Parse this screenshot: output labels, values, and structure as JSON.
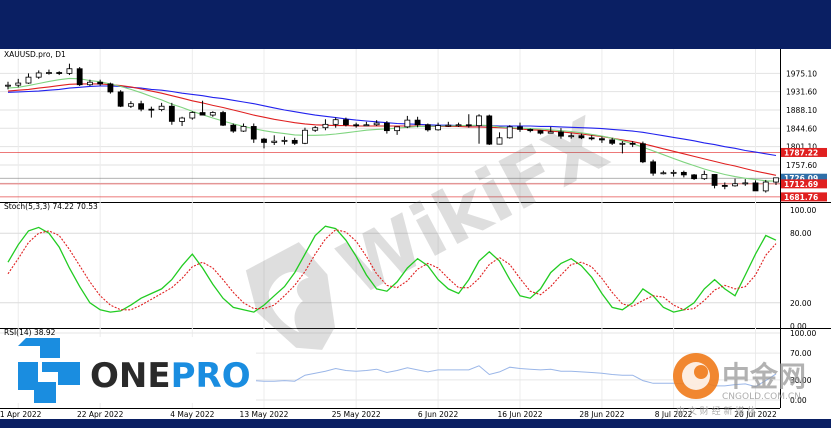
{
  "colors": {
    "frame": "#0a1f63",
    "panel_bg": "#ffffff",
    "grid": "#d8d8d8",
    "bull_fill": "#ffffff",
    "bear_fill": "#000000",
    "ma_blue": "#2222ee",
    "ma_red": "#e02020",
    "ma_green": "#7fd47f",
    "stoch_k": "#22cc22",
    "stoch_d": "#e02020",
    "rsi_line": "#9ab6e8",
    "tag_red": "#e02020",
    "tag_blue": "#2f6fa8",
    "logo_blue": "#1a8de0",
    "logo_text": "#2a2a2a",
    "watermark_orange": "#f07a1a"
  },
  "price_panel": {
    "label": "XAUUSD.pro, D1",
    "axis_ticks": [
      "1975.10",
      "1931.60",
      "1888.10",
      "1844.60",
      "1801.10",
      "1757.60",
      "1714.10"
    ],
    "price_tags": [
      {
        "text": "1787.22",
        "color": "red"
      },
      {
        "text": "1726.09",
        "color": "blue"
      },
      {
        "text": "1712.69",
        "color": "red"
      },
      {
        "text": "1681.76",
        "color": "red"
      }
    ]
  },
  "stoch_panel": {
    "label": "Stoch(5,3,3) 74.22 70.53",
    "axis_ticks": [
      "100.00",
      "80.00",
      "20.00",
      "0.00"
    ]
  },
  "rsi_panel": {
    "label": "RSI(14) 38.92",
    "axis_ticks": [
      "100.00",
      "70.00",
      "30.00",
      "0.00"
    ]
  },
  "x_axis": {
    "labels": [
      "11 Apr 2022",
      "22 Apr 2022",
      "4 May 2022",
      "13 May 2022",
      "25 May 2022",
      "6 Jun 2022",
      "16 Jun 2022",
      "28 Jun 2022",
      "8 Jul 2022",
      "20 Jul 2022"
    ]
  },
  "branding": {
    "logo_left": "ONE",
    "logo_right": "PRO",
    "watermark": "WikiFX",
    "cngold_name": "中金网",
    "cngold_url": "CNGOLD.COM.CN",
    "cngold_tagline": "中 文 财 经 新 媒 体"
  },
  "chart_data": [
    {
      "type": "candlestick",
      "symbol": "XAUUSD.pro",
      "timeframe": "D1",
      "title": "XAUUSD.pro, D1",
      "ylim": [
        1672,
        2002
      ],
      "x": [
        "2022-04-08",
        "2022-04-11",
        "2022-04-12",
        "2022-04-13",
        "2022-04-14",
        "2022-04-15",
        "2022-04-18",
        "2022-04-19",
        "2022-04-20",
        "2022-04-21",
        "2022-04-22",
        "2022-04-25",
        "2022-04-26",
        "2022-04-27",
        "2022-04-28",
        "2022-04-29",
        "2022-05-02",
        "2022-05-03",
        "2022-05-04",
        "2022-05-05",
        "2022-05-06",
        "2022-05-09",
        "2022-05-10",
        "2022-05-11",
        "2022-05-12",
        "2022-05-13",
        "2022-05-16",
        "2022-05-17",
        "2022-05-18",
        "2022-05-19",
        "2022-05-20",
        "2022-05-23",
        "2022-05-24",
        "2022-05-25",
        "2022-05-26",
        "2022-05-27",
        "2022-05-30",
        "2022-05-31",
        "2022-06-01",
        "2022-06-02",
        "2022-06-03",
        "2022-06-06",
        "2022-06-07",
        "2022-06-08",
        "2022-06-09",
        "2022-06-10",
        "2022-06-13",
        "2022-06-14",
        "2022-06-15",
        "2022-06-16",
        "2022-06-17",
        "2022-06-20",
        "2022-06-21",
        "2022-06-22",
        "2022-06-23",
        "2022-06-24",
        "2022-06-27",
        "2022-06-28",
        "2022-06-29",
        "2022-06-30",
        "2022-07-01",
        "2022-07-04",
        "2022-07-05",
        "2022-07-06",
        "2022-07-07",
        "2022-07-08",
        "2022-07-11",
        "2022-07-12",
        "2022-07-13",
        "2022-07-14",
        "2022-07-15",
        "2022-07-18",
        "2022-07-19",
        "2022-07-20",
        "2022-07-21",
        "2022-07-22"
      ],
      "open": [
        1945,
        1947,
        1952,
        1966,
        1976,
        1977,
        1975,
        1986,
        1948,
        1954,
        1950,
        1931,
        1897,
        1903,
        1890,
        1889,
        1897,
        1861,
        1869,
        1882,
        1876,
        1882,
        1852,
        1838,
        1849,
        1819,
        1811,
        1814,
        1816,
        1809,
        1840,
        1846,
        1854,
        1865,
        1853,
        1852,
        1853,
        1857,
        1839,
        1848,
        1864,
        1853,
        1841,
        1851,
        1852,
        1853,
        1851,
        1874,
        1807,
        1822,
        1848,
        1842,
        1839,
        1833,
        1836,
        1826,
        1827,
        1822,
        1820,
        1817,
        1809,
        1809,
        1808,
        1765,
        1738,
        1739,
        1740,
        1734,
        1725,
        1735,
        1709,
        1708,
        1713,
        1715,
        1696,
        1717
      ],
      "high": [
        1955,
        1962,
        1975,
        1982,
        1984,
        1980,
        1998,
        1990,
        1960,
        1960,
        1953,
        1935,
        1909,
        1910,
        1896,
        1905,
        1905,
        1872,
        1885,
        1910,
        1885,
        1886,
        1856,
        1856,
        1856,
        1822,
        1828,
        1825,
        1822,
        1846,
        1850,
        1866,
        1870,
        1870,
        1858,
        1860,
        1864,
        1862,
        1847,
        1874,
        1872,
        1856,
        1858,
        1860,
        1858,
        1878,
        1878,
        1877,
        1835,
        1852,
        1858,
        1844,
        1840,
        1848,
        1845,
        1834,
        1832,
        1828,
        1825,
        1822,
        1814,
        1814,
        1813,
        1770,
        1744,
        1746,
        1744,
        1736,
        1744,
        1736,
        1716,
        1725,
        1724,
        1721,
        1722,
        1727
      ],
      "low": [
        1937,
        1942,
        1950,
        1962,
        1972,
        1971,
        1971,
        1945,
        1945,
        1946,
        1927,
        1895,
        1893,
        1885,
        1870,
        1885,
        1853,
        1850,
        1865,
        1875,
        1872,
        1850,
        1834,
        1836,
        1810,
        1797,
        1805,
        1806,
        1805,
        1807,
        1836,
        1840,
        1846,
        1849,
        1846,
        1850,
        1850,
        1832,
        1829,
        1845,
        1847,
        1837,
        1839,
        1848,
        1848,
        1846,
        1808,
        1805,
        1806,
        1820,
        1836,
        1835,
        1830,
        1833,
        1820,
        1820,
        1819,
        1816,
        1810,
        1805,
        1785,
        1800,
        1762,
        1732,
        1735,
        1730,
        1728,
        1722,
        1722,
        1702,
        1700,
        1706,
        1708,
        1698,
        1692,
        1710
      ],
      "close": [
        1947,
        1952,
        1966,
        1976,
        1977,
        1975,
        1986,
        1948,
        1954,
        1950,
        1931,
        1897,
        1903,
        1890,
        1889,
        1897,
        1861,
        1869,
        1882,
        1876,
        1882,
        1852,
        1838,
        1849,
        1819,
        1811,
        1814,
        1816,
        1809,
        1840,
        1846,
        1854,
        1865,
        1853,
        1852,
        1853,
        1857,
        1839,
        1848,
        1864,
        1853,
        1841,
        1851,
        1852,
        1853,
        1851,
        1874,
        1807,
        1822,
        1848,
        1842,
        1839,
        1833,
        1836,
        1826,
        1827,
        1822,
        1820,
        1817,
        1809,
        1809,
        1808,
        1765,
        1738,
        1739,
        1740,
        1734,
        1725,
        1735,
        1709,
        1708,
        1713,
        1715,
        1696,
        1717,
        1727
      ],
      "series": [
        {
          "values": [
            1930,
            1931,
            1932,
            1933,
            1935,
            1937,
            1940,
            1942,
            1944,
            1945,
            1945,
            1944,
            1942,
            1940,
            1937,
            1935,
            1932,
            1928,
            1925,
            1922,
            1918,
            1915,
            1911,
            1907,
            1903,
            1898,
            1893,
            1888,
            1884,
            1880,
            1876,
            1873,
            1870,
            1867,
            1864,
            1862,
            1860,
            1858,
            1856,
            1855,
            1854,
            1853,
            1852,
            1852,
            1851,
            1851,
            1851,
            1851,
            1850,
            1850,
            1850,
            1850,
            1849,
            1849,
            1848,
            1847,
            1846,
            1845,
            1844,
            1842,
            1840,
            1838,
            1835,
            1831,
            1827,
            1823,
            1819,
            1815,
            1810,
            1806,
            1801,
            1797,
            1792,
            1788,
            1784,
            1780
          ]
        },
        {
          "values": [
            1933,
            1935,
            1937,
            1940,
            1943,
            1946,
            1949,
            1950,
            1950,
            1950,
            1948,
            1946,
            1943,
            1938,
            1933,
            1928,
            1922,
            1916,
            1910,
            1905,
            1899,
            1894,
            1888,
            1882,
            1876,
            1871,
            1866,
            1862,
            1858,
            1855,
            1853,
            1852,
            1851,
            1851,
            1850,
            1850,
            1850,
            1850,
            1850,
            1850,
            1850,
            1849,
            1849,
            1849,
            1849,
            1848,
            1848,
            1847,
            1846,
            1845,
            1843,
            1841,
            1840,
            1838,
            1836,
            1834,
            1831,
            1828,
            1825,
            1821,
            1817,
            1813,
            1808,
            1802,
            1796,
            1790,
            1784,
            1778,
            1772,
            1766,
            1760,
            1755,
            1749,
            1743,
            1738,
            1733
          ]
        },
        {
          "values": [
            1940,
            1942,
            1946,
            1951,
            1956,
            1960,
            1963,
            1962,
            1958,
            1955,
            1950,
            1944,
            1937,
            1929,
            1920,
            1912,
            1902,
            1894,
            1885,
            1877,
            1869,
            1862,
            1855,
            1849,
            1844,
            1839,
            1835,
            1832,
            1829,
            1828,
            1828,
            1829,
            1831,
            1834,
            1837,
            1840,
            1842,
            1843,
            1845,
            1847,
            1849,
            1849,
            1850,
            1850,
            1851,
            1851,
            1852,
            1851,
            1848,
            1846,
            1845,
            1844,
            1843,
            1841,
            1839,
            1837,
            1834,
            1830,
            1826,
            1821,
            1815,
            1808,
            1800,
            1791,
            1782,
            1773,
            1764,
            1756,
            1748,
            1741,
            1735,
            1730,
            1726,
            1723,
            1720,
            1719
          ]
        }
      ]
    },
    {
      "type": "line",
      "title": "Stoch(5,3,3) 74.22 70.53",
      "ylim": [
        0,
        100
      ],
      "series": [
        {
          "values": [
            55,
            70,
            82,
            85,
            80,
            68,
            50,
            34,
            20,
            14,
            12,
            13,
            18,
            24,
            28,
            32,
            40,
            52,
            62,
            50,
            36,
            24,
            16,
            14,
            12,
            18,
            26,
            34,
            46,
            62,
            78,
            86,
            84,
            74,
            60,
            44,
            32,
            30,
            38,
            50,
            58,
            52,
            40,
            32,
            28,
            40,
            56,
            64,
            56,
            40,
            26,
            24,
            32,
            46,
            54,
            58,
            52,
            42,
            28,
            16,
            14,
            20,
            32,
            26,
            16,
            12,
            14,
            20,
            32,
            40,
            32,
            26,
            44,
            62,
            78,
            74
          ]
        },
        {
          "values": [
            45,
            58,
            72,
            80,
            82,
            78,
            66,
            52,
            38,
            26,
            18,
            14,
            14,
            18,
            23,
            28,
            33,
            41,
            51,
            55,
            50,
            40,
            29,
            20,
            15,
            15,
            18,
            26,
            35,
            47,
            62,
            75,
            83,
            81,
            73,
            60,
            45,
            35,
            33,
            39,
            49,
            54,
            50,
            41,
            33,
            33,
            41,
            53,
            59,
            53,
            41,
            30,
            27,
            34,
            44,
            53,
            55,
            51,
            41,
            29,
            19,
            17,
            22,
            26,
            25,
            18,
            14,
            15,
            22,
            31,
            35,
            32,
            34,
            44,
            61,
            71
          ]
        }
      ]
    },
    {
      "type": "line",
      "title": "RSI(14) 38.92",
      "ylim": [
        0,
        100
      ],
      "series": [
        {
          "values": [
            60,
            61,
            63,
            65,
            65,
            64,
            66,
            55,
            57,
            56,
            50,
            41,
            43,
            39,
            39,
            42,
            34,
            36,
            40,
            38,
            40,
            34,
            31,
            34,
            29,
            28,
            28,
            29,
            28,
            37,
            40,
            43,
            47,
            44,
            43,
            44,
            46,
            41,
            44,
            48,
            45,
            42,
            45,
            45,
            45,
            45,
            51,
            38,
            42,
            49,
            47,
            46,
            45,
            46,
            43,
            43,
            42,
            41,
            40,
            38,
            37,
            37,
            29,
            25,
            25,
            25,
            24,
            22,
            26,
            21,
            21,
            23,
            24,
            20,
            29,
            39
          ]
        }
      ]
    }
  ]
}
